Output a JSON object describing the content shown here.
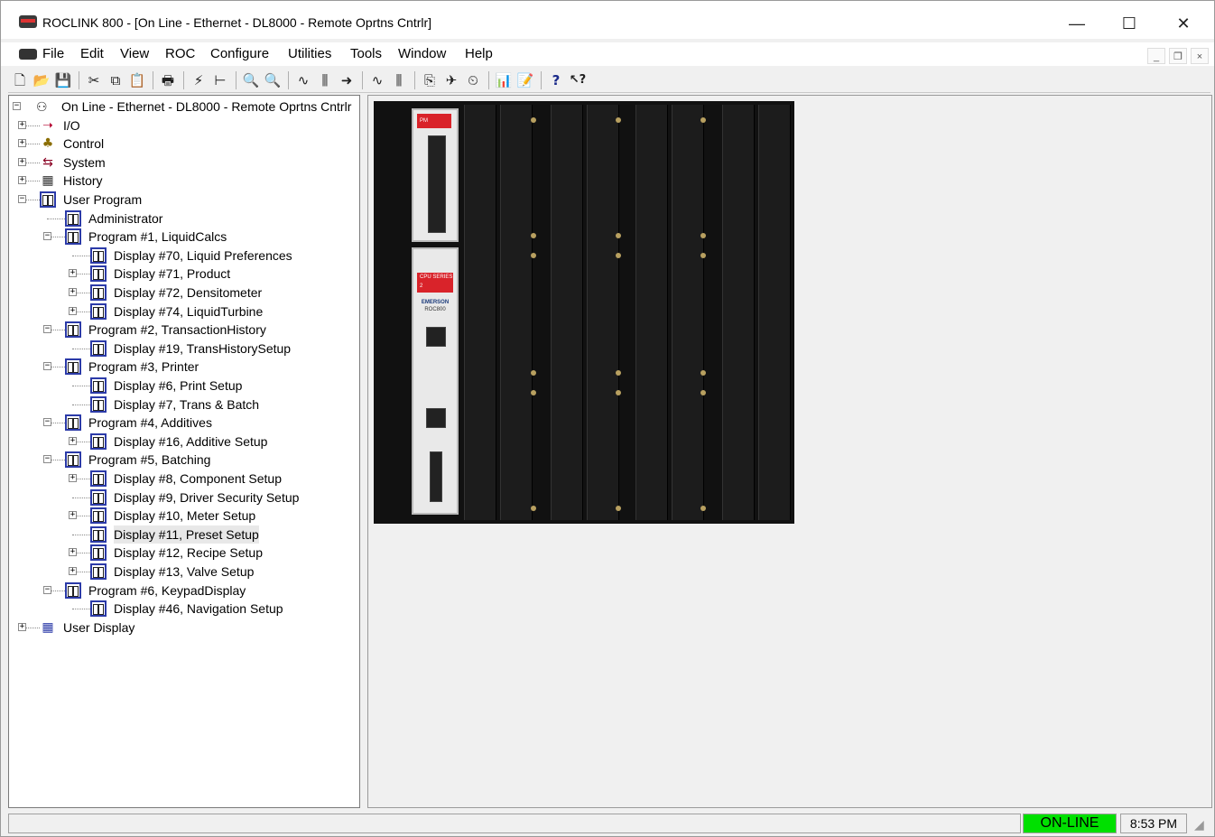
{
  "window": {
    "title": "ROCLINK 800 - [On Line - Ethernet - DL8000 - Remote Oprtns Cntrlr]",
    "minimize_glyph": "—",
    "maximize_glyph": "☐",
    "close_glyph": "✕"
  },
  "menubar": {
    "items": [
      "File",
      "Edit",
      "View",
      "ROC",
      "Configure",
      "Utilities",
      "Tools",
      "Window",
      "Help"
    ],
    "mdi_minimize": "_",
    "mdi_restore": "❐",
    "mdi_close": "×"
  },
  "toolbar": {
    "icons": [
      "new-file-icon",
      "open-folder-icon",
      "save-icon",
      "cut-icon",
      "copy-icon",
      "paste-icon",
      "print-icon",
      "connect-icon",
      "tree-icon",
      "zoom-in-icon",
      "zoom-out-icon",
      "waveform-icon",
      "io-icon",
      "flow-icon",
      "trend-icon",
      "plot-icon",
      "direct-connect-icon",
      "update-icon",
      "clock-icon",
      "chart-icon",
      "report-icon",
      "help-icon",
      "context-help-icon"
    ],
    "glyphs": [
      "🗋",
      "📂",
      "💾",
      "✂",
      "⧉",
      "📋",
      "🖶",
      "⚡",
      "⊢",
      "🔍",
      "🔍",
      "∿",
      "⫼",
      "➜",
      "∿",
      "⫼",
      "⎘",
      "✈",
      "⏲",
      "📊",
      "📝",
      "?",
      "↖?"
    ]
  },
  "tree": {
    "root": "On Line - Ethernet - DL8000 - Remote Oprtns Cntrlr",
    "nodes": [
      {
        "label": "I/O",
        "icon": "io-icon",
        "level": 1,
        "expander": "+"
      },
      {
        "label": "Control",
        "icon": "control-icon",
        "level": 1,
        "expander": "+"
      },
      {
        "label": "System",
        "icon": "system-icon",
        "level": 1,
        "expander": "+"
      },
      {
        "label": "History",
        "icon": "history-icon",
        "level": 1,
        "expander": "+"
      },
      {
        "label": "User Program",
        "icon": "program-icon",
        "level": 1,
        "expander": "−"
      },
      {
        "label": "Administrator",
        "icon": "program-icon",
        "level": 2,
        "expander": ""
      },
      {
        "label": "Program #1, LiquidCalcs",
        "icon": "program-icon",
        "level": 2,
        "expander": "−"
      },
      {
        "label": "Display #70, Liquid Preferences",
        "icon": "program-icon",
        "level": 3,
        "expander": ""
      },
      {
        "label": "Display #71, Product",
        "icon": "program-icon",
        "level": 3,
        "expander": "+"
      },
      {
        "label": "Display #72, Densitometer",
        "icon": "program-icon",
        "level": 3,
        "expander": "+"
      },
      {
        "label": "Display #74, LiquidTurbine",
        "icon": "program-icon",
        "level": 3,
        "expander": "+"
      },
      {
        "label": "Program #2, TransactionHistory",
        "icon": "program-icon",
        "level": 2,
        "expander": "−"
      },
      {
        "label": "Display #19, TransHistorySetup",
        "icon": "program-icon",
        "level": 3,
        "expander": ""
      },
      {
        "label": "Program #3, Printer",
        "icon": "program-icon",
        "level": 2,
        "expander": "−"
      },
      {
        "label": "Display #6, Print Setup",
        "icon": "program-icon",
        "level": 3,
        "expander": ""
      },
      {
        "label": "Display #7, Trans & Batch",
        "icon": "program-icon",
        "level": 3,
        "expander": ""
      },
      {
        "label": "Program #4, Additives",
        "icon": "program-icon",
        "level": 2,
        "expander": "−"
      },
      {
        "label": "Display #16, Additive Setup",
        "icon": "program-icon",
        "level": 3,
        "expander": "+"
      },
      {
        "label": "Program #5, Batching",
        "icon": "program-icon",
        "level": 2,
        "expander": "−"
      },
      {
        "label": "Display #8, Component Setup",
        "icon": "program-icon",
        "level": 3,
        "expander": "+"
      },
      {
        "label": "Display #9, Driver Security Setup",
        "icon": "program-icon",
        "level": 3,
        "expander": ""
      },
      {
        "label": "Display #10, Meter Setup",
        "icon": "program-icon",
        "level": 3,
        "expander": "+"
      },
      {
        "label": "Display #11, Preset Setup",
        "icon": "program-icon",
        "level": 3,
        "expander": "",
        "selected": true
      },
      {
        "label": "Display #12, Recipe Setup",
        "icon": "program-icon",
        "level": 3,
        "expander": "+"
      },
      {
        "label": "Display #13, Valve Setup",
        "icon": "program-icon",
        "level": 3,
        "expander": "+"
      },
      {
        "label": "Program #6, KeypadDisplay",
        "icon": "program-icon",
        "level": 2,
        "expander": "−"
      },
      {
        "label": "Display #46, Navigation Setup",
        "icon": "program-icon",
        "level": 3,
        "expander": ""
      },
      {
        "label": "User Display",
        "icon": "user-display-icon",
        "level": 1,
        "expander": "+"
      }
    ]
  },
  "device_image": {
    "module_label_top": "PM",
    "module_label_cpu": "CPU SERIES 2",
    "brand": "EMERSON",
    "model": "ROC800"
  },
  "statusbar": {
    "connection_status": "ON-LINE",
    "time": "8:53 PM"
  },
  "colors": {
    "online_green": "#00e000",
    "program_icon_blue": "#2b3aa8"
  }
}
